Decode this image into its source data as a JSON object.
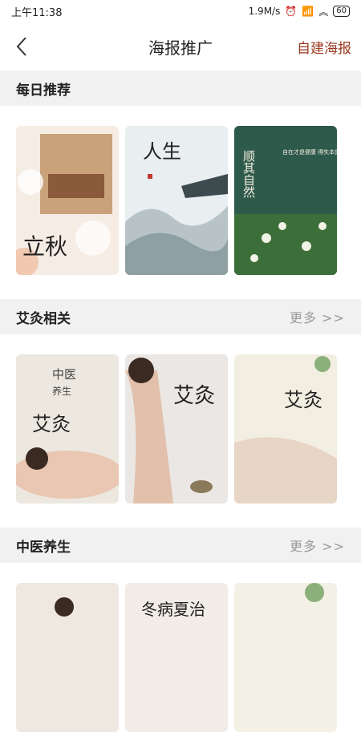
{
  "status_bar": {
    "time": "上午11:38",
    "network_speed": "1.9M/s",
    "battery": "60"
  },
  "nav": {
    "title": "海报推广",
    "action": "自建海报",
    "back_icon": "chevron-left-icon",
    "accent_color": "#9a3a1f"
  },
  "sections": [
    {
      "title": "每日推荐",
      "more": ""
    },
    {
      "title": "艾灸相关",
      "more": "更多 >>"
    },
    {
      "title": "中医养生",
      "more": "更多 >>"
    }
  ],
  "daily_posters": [
    {
      "calligraphy": "立秋"
    },
    {
      "calligraphy": "人生"
    },
    {
      "calligraphy": "顺其自然",
      "small_text": "自在才是健康 得失本是平常"
    }
  ],
  "moxa_posters": [
    {
      "calligraphy": "中医",
      "sub": "养生",
      "main": "艾灸"
    },
    {
      "calligraphy": "艾灸"
    },
    {
      "calligraphy": "艾灸"
    }
  ],
  "tcm_posters": [
    {
      "calligraphy": ""
    },
    {
      "calligraphy": "冬病夏治"
    },
    {
      "calligraphy": ""
    }
  ]
}
